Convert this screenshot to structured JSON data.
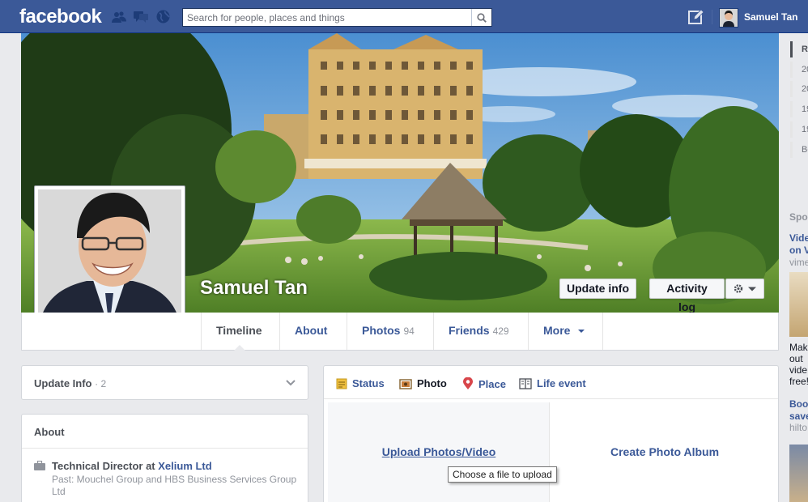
{
  "topbar": {
    "logo": "facebook",
    "search_placeholder": "Search for people, places and things",
    "user_name": "Samuel Tan"
  },
  "profile": {
    "name": "Samuel Tan",
    "update_info_btn": "Update info",
    "activity_log_btn": "Activity log"
  },
  "nav": {
    "tabs": [
      {
        "label": "Timeline",
        "count": ""
      },
      {
        "label": "About",
        "count": ""
      },
      {
        "label": "Photos",
        "count": "94"
      },
      {
        "label": "Friends",
        "count": "429"
      },
      {
        "label": "More",
        "count": ""
      }
    ]
  },
  "left": {
    "update_info": {
      "title": "Update Info",
      "count": "· 2"
    },
    "about": {
      "title": "About",
      "job_prefix": "Technical Director at ",
      "job_company": "Xelium Ltd",
      "past": "Past: Mouchel Group and HBS Business Services Group Ltd"
    }
  },
  "composer": {
    "tabs": [
      {
        "label": "Status"
      },
      {
        "label": "Photo"
      },
      {
        "label": "Place"
      },
      {
        "label": "Life event"
      }
    ],
    "upload_label": "Upload Photos/Video",
    "album_label": "Create Photo Album",
    "tooltip": "Choose a file to upload"
  },
  "rail": {
    "years": [
      "R",
      "20",
      "20",
      "19",
      "19",
      "Bo"
    ],
    "sponsored": "Spo",
    "ads": [
      {
        "lines": [
          "Vide",
          "on V"
        ],
        "sub": "vime"
      },
      {
        "lines": [
          "Make",
          "out",
          "vide",
          "free!"
        ]
      },
      {
        "lines": [
          "Boo",
          "save"
        ],
        "sub": "hilto"
      }
    ]
  },
  "colors": {
    "brand": "#3b5998",
    "background": "#e9eaed",
    "link": "#3b5998"
  }
}
